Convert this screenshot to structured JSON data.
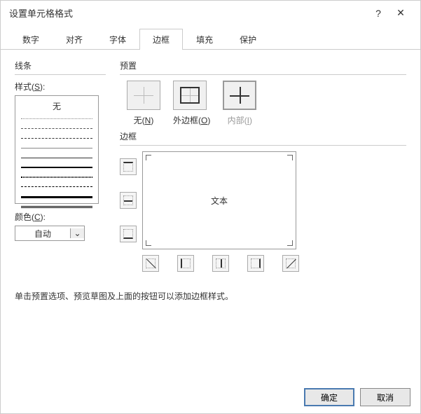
{
  "title": "设置单元格格式",
  "tabs": [
    "数字",
    "对齐",
    "字体",
    "边框",
    "填充",
    "保护"
  ],
  "active_tab_index": 3,
  "line_section": "线条",
  "style_label": "样式(S):",
  "style_none": "无",
  "color_label": "颜色(C):",
  "color_value": "自动",
  "preset_section": "预置",
  "preset_none": "无(N)",
  "preset_outline": "外边框(O)",
  "preset_inner": "内部(I)",
  "border_section": "边框",
  "preview_text": "文本",
  "help_text": "单击预置选项、预览草图及上面的按钮可以添加边框样式。",
  "ok": "确定",
  "cancel": "取消"
}
